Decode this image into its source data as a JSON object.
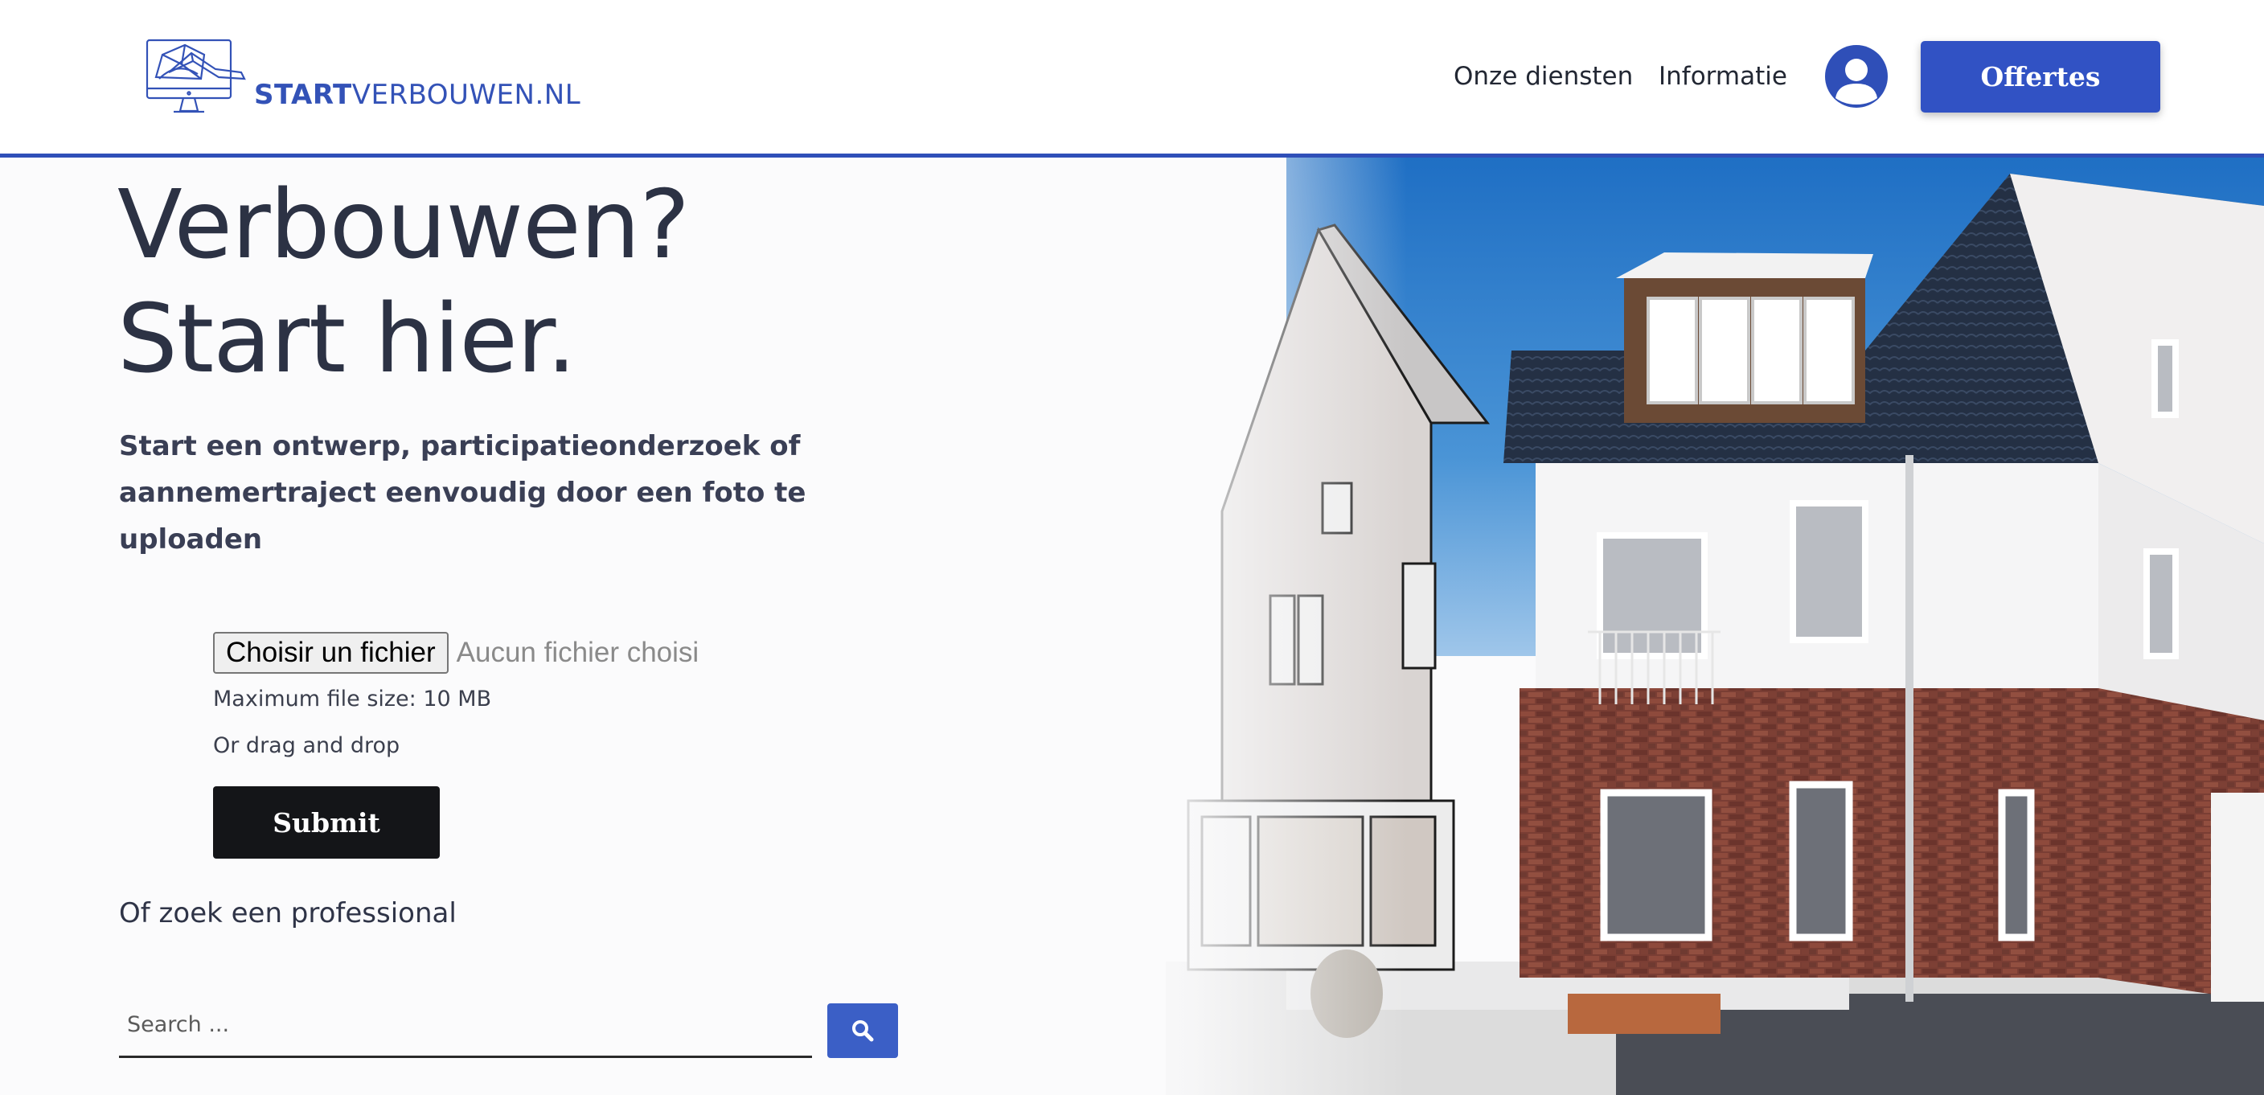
{
  "brand": {
    "name_bold": "START",
    "name_rest": "VERBOUWEN.NL",
    "color": "#3352b7",
    "logo_icon": "monitor-blueprint-icon"
  },
  "nav": {
    "items": [
      {
        "label": "Onze diensten"
      },
      {
        "label": "Informatie"
      }
    ],
    "account_icon": "user-icon",
    "cta_label": "Offertes",
    "cta_color": "#3152c4"
  },
  "hero": {
    "title_line1": "Verbouwen?",
    "title_line2": "Start hier.",
    "subtitle": "Start een ontwerp, participatieonderzoek of aannemertraject eenvoudig door een foto te uploaden",
    "image_icon": "house-photo"
  },
  "upload": {
    "choose_label": "Choisir un fichier",
    "status": "Aucun fichier choisi",
    "max_size": "Maximum file size: 10 MB",
    "drag_hint": "Or drag and drop",
    "submit_label": "Submit"
  },
  "search": {
    "label": "Of zoek een professional",
    "placeholder": "Search ...",
    "button_icon": "search-icon",
    "button_color": "#3b5fc6"
  },
  "colors": {
    "accent": "#2f4fb8",
    "text_dark": "#2c3244",
    "submit_bg": "#141518"
  }
}
